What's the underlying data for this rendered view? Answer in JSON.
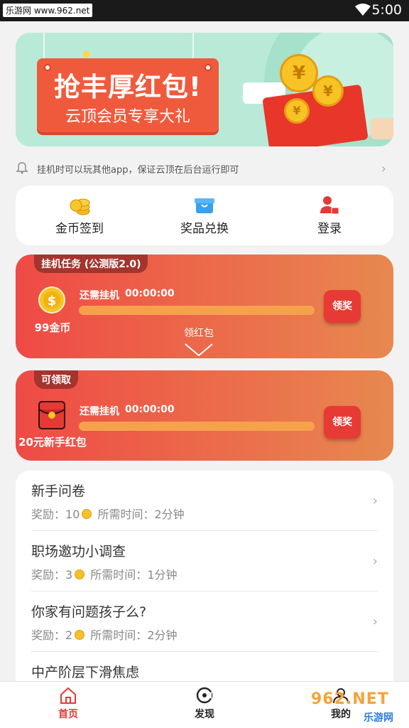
{
  "status_bar": {
    "watermark": "乐游网 www.962.net",
    "time": "5:00"
  },
  "banner": {
    "title": "抢丰厚红包!",
    "subtitle": "云顶会员专享大礼",
    "coin_symbol": "¥"
  },
  "notice": {
    "text": "挂机时可以玩其他app，保证云顶在后台运行即可"
  },
  "quick_actions": [
    {
      "label": "金币签到",
      "icon": "coins-icon"
    },
    {
      "label": "奖品兑换",
      "icon": "gift-box-icon"
    },
    {
      "label": "登录",
      "icon": "user-lock-icon"
    }
  ],
  "task_card_1": {
    "tag": "挂机任务 (公测版2.0)",
    "status_label": "还需挂机",
    "timer": "00:00:00",
    "reward": "99金币",
    "coin_symbol": "$",
    "claim": "领奖",
    "expand_label": "领红包",
    "progress": 0
  },
  "task_card_2": {
    "tag": "可领取",
    "status_label": "还需挂机",
    "timer": "00:00:00",
    "reward": "20元新手红包",
    "claim": "领奖",
    "progress": 0
  },
  "surveys": {
    "reward_label": "奖励：",
    "time_label": "所需时间：",
    "items": [
      {
        "title": "新手问卷",
        "reward": "10",
        "time": "2分钟"
      },
      {
        "title": "职场邀功小调查",
        "reward": "3",
        "time": "1分钟"
      },
      {
        "title": "你家有问题孩子么?",
        "reward": "2",
        "time": "2分钟"
      },
      {
        "title": "中产阶层下滑焦虑",
        "reward": "",
        "time": ""
      }
    ]
  },
  "tabs": [
    {
      "label": "首页",
      "active": true
    },
    {
      "label": "发现",
      "active": false
    },
    {
      "label": "我的",
      "active": false
    }
  ],
  "overlay_watermark": {
    "logo": "962.NET",
    "sub": "乐游网"
  },
  "colors": {
    "accent": "#e83a34",
    "banner_bg": "#b9ead8",
    "card_gradient_start": "#ef4a45",
    "card_gradient_end": "#e8884f"
  }
}
